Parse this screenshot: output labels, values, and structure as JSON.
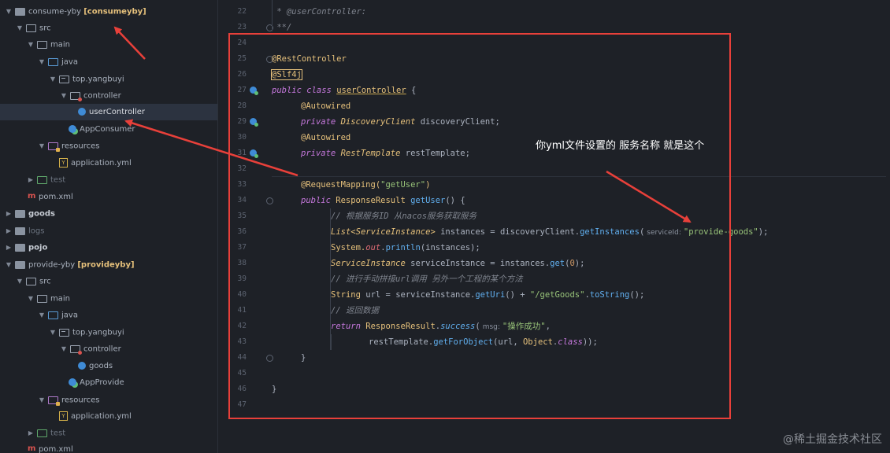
{
  "project_tree": {
    "items": [
      {
        "label": "consume-yby",
        "tag": "[consumeyby]"
      },
      {
        "label": "src"
      },
      {
        "label": "main"
      },
      {
        "label": "java"
      },
      {
        "label": "top.yangbuyi"
      },
      {
        "label": "controller"
      },
      {
        "label": "userController"
      },
      {
        "label": "AppConsumer"
      },
      {
        "label": "resources"
      },
      {
        "label": "application.yml"
      },
      {
        "label": "test"
      },
      {
        "label": "pom.xml"
      },
      {
        "label": "goods"
      },
      {
        "label": "logs"
      },
      {
        "label": "pojo"
      },
      {
        "label": "provide-yby",
        "tag": "[provideyby]"
      },
      {
        "label": "src"
      },
      {
        "label": "main"
      },
      {
        "label": "java"
      },
      {
        "label": "top.yangbuyi"
      },
      {
        "label": "controller"
      },
      {
        "label": "goods"
      },
      {
        "label": "AppProvide"
      },
      {
        "label": "resources"
      },
      {
        "label": "application.yml"
      },
      {
        "label": "test"
      },
      {
        "label": "pom.xml"
      }
    ]
  },
  "editor": {
    "line_numbers": [
      "22",
      "23",
      "24",
      "25",
      "26",
      "27",
      "28",
      "29",
      "30",
      "31",
      "32",
      "33",
      "34",
      "35",
      "36",
      "37",
      "38",
      "39",
      "40",
      "41",
      "42",
      "43",
      "44",
      "45",
      "46",
      "47"
    ],
    "code": {
      "l22_comment": " * @userController:",
      "l23_comment": " **/",
      "l25_ann": "@RestController",
      "l26_ann": "@Slf4j",
      "l27_kw": "public class ",
      "l27_name": "userController",
      "l27_rest": " {",
      "l28_ann": "@Autowired",
      "l29_kw": "private ",
      "l29_type": "DiscoveryClient",
      "l29_rest": " discoveryClient;",
      "l30_ann": "@Autowired",
      "l31_kw": "private ",
      "l31_type": "RestTemplate",
      "l31_rest": " restTemplate;",
      "l33_ann": "@RequestMapping(",
      "l33_str": "\"getUser\"",
      "l33_end": ")",
      "l34_kw": "public ",
      "l34_type": "ResponseResult",
      "l34_fn": " getUser",
      "l34_rest": "() {",
      "l35_comment": "// 根据服务ID 从nacos服务获取服务",
      "l36_type": "List",
      "l36_gen": "<ServiceInstance>",
      "l36_mid": " instances = discoveryClient.",
      "l36_fn": "getInstances",
      "l36_open": "(",
      "l36_hint": "serviceId:",
      "l36_str": "\"provide-goods\"",
      "l36_end": ");",
      "l37_a": "System.",
      "l37_fld": "out",
      "l37_b": ".",
      "l37_fn": "println",
      "l37_rest": "(instances);",
      "l38_type": "ServiceInstance",
      "l38_mid": " serviceInstance = instances.",
      "l38_fn": "get",
      "l38_open": "(",
      "l38_num": "0",
      "l38_end": ");",
      "l39_comment": "// 进行手动拼接url调用 另外一个工程的某个方法",
      "l40_type": "String",
      "l40_mid": " url = serviceInstance.",
      "l40_fn": "getUri",
      "l40_mid2": "() + ",
      "l40_str": "\"/getGoods\"",
      "l40_dot": ".",
      "l40_fn2": "toString",
      "l40_end": "();",
      "l41_comment": "// 返回数据",
      "l42_kw": "return ",
      "l42_type": "ResponseResult",
      "l42_dot": ".",
      "l42_fn": "success",
      "l42_open": "(",
      "l42_hint": "msg:",
      "l42_str": "\"操作成功\"",
      "l42_end": ",",
      "l43_a": "restTemplate.",
      "l43_fn": "getForObject",
      "l43_mid": "(url, ",
      "l43_type": "Object",
      "l43_dot": ".",
      "l43_kw": "class",
      "l43_end": "));",
      "l44": "}",
      "l46": "}"
    }
  },
  "annotation": {
    "note": "你yml文件设置的 服务名称 就是这个",
    "watermark": "@稀土掘金技术社区",
    "box_color": "#e8403a"
  }
}
